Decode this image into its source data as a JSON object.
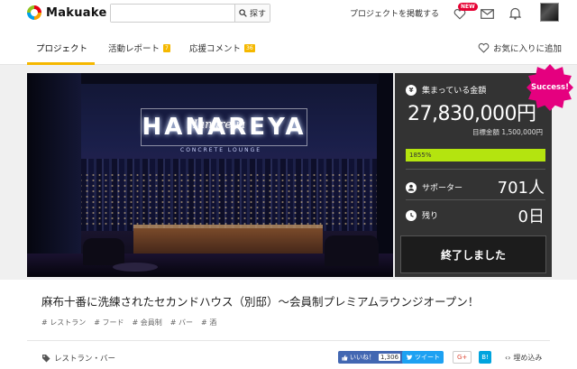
{
  "header": {
    "logo_text": "Makuake",
    "search": {
      "placeholder": "",
      "button_label": "探す"
    },
    "post_project_label": "プロジェクトを掲載する",
    "new_badge": "NEW"
  },
  "tabs": {
    "project": "プロジェクト",
    "reports": {
      "label": "活動レポート",
      "count": "7"
    },
    "comments": {
      "label": "応援コメント",
      "count": "36"
    },
    "favorite_label": "お気に入りに追加"
  },
  "hero": {
    "neon_text": "HANAREYA",
    "script_text": "Hanareya",
    "sub_text": "CONCRETE LOUNGE"
  },
  "panel": {
    "collected_label": "集まっている金額",
    "amount": "27,830,000円",
    "goal": "目標金額 1,500,000円",
    "percent": "1855%",
    "percent_value": 100,
    "supporters_label": "サポーター",
    "supporters": "701人",
    "remaining_label": "残り",
    "remaining": "0日",
    "ended_button": "終了しました",
    "success_badge": "Success!"
  },
  "project": {
    "title": "麻布十番に洗練されたセカンドハウス（別邸）〜会員制プレミアムラウンジオープン！",
    "tags": [
      "# レストラン",
      "# フード",
      "# 会員制",
      "# バー",
      "# 酒"
    ],
    "category": "レストラン・バー"
  },
  "share": {
    "like_label": "いいね！",
    "like_count": "1,306",
    "tweet_label": "ツイート",
    "gplus_label": "G+",
    "hatena_label": "B!",
    "embed_label": "埋め込み"
  },
  "colors": {
    "accent": "#f5b800",
    "progress": "#b4e40f",
    "success": "#e5007f",
    "panel_bg": "#333333"
  }
}
